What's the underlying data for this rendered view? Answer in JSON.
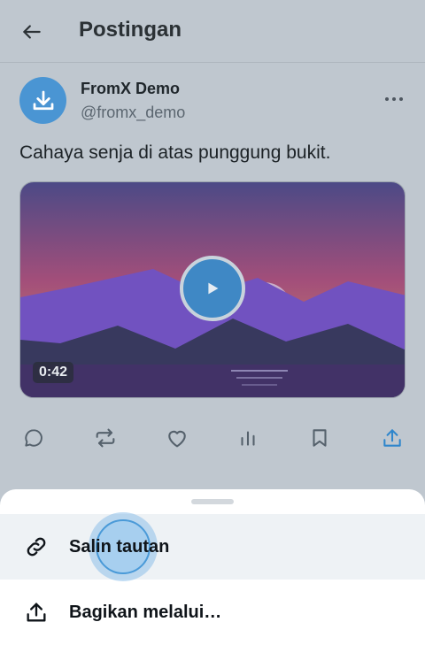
{
  "header": {
    "title": "Postingan"
  },
  "post": {
    "author_name": "FromX Demo",
    "author_handle": "@fromx_demo",
    "text": "Cahaya senja di atas punggung bukit.",
    "video_duration": "0:42"
  },
  "colors": {
    "accent": "#4a95d3",
    "sheet_highlight": "#eef2f5"
  },
  "share_sheet": {
    "items": [
      {
        "label": "Salin tautan",
        "icon": "link-icon"
      },
      {
        "label": "Bagikan melalui…",
        "icon": "share-icon"
      }
    ]
  }
}
